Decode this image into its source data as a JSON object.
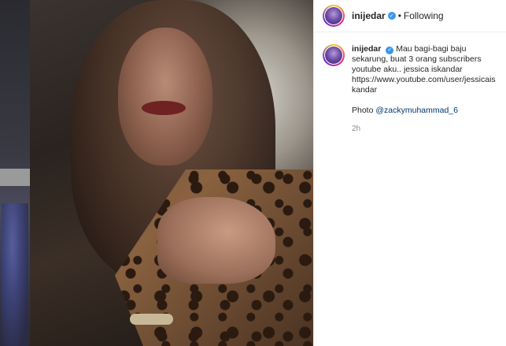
{
  "post": {
    "username": "inijedar",
    "follow_status": "Following",
    "dot": "•",
    "caption": "Mau bagi-bagi baju sekarung, buat 3 orang subscribers youtube aku.. jessica iskandar https://www.youtube.com/user/jessicaiskandar",
    "credit_prefix": "Photo",
    "credit_mention": "@zackymuhammad_6",
    "timestamp": "2h"
  },
  "icons": {
    "verified": "verified-badge-icon"
  },
  "colors": {
    "verified": "#3897f0",
    "mention": "#00376b",
    "text": "#262626",
    "muted": "#8e8e8e"
  }
}
